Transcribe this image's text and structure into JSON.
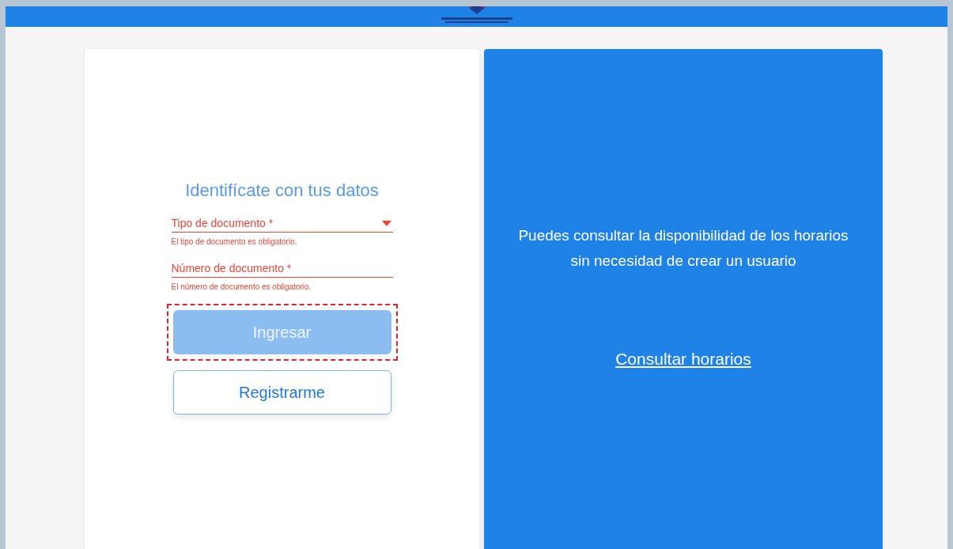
{
  "login": {
    "title": "Identifícate con tus datos",
    "fields": [
      {
        "kind": "select",
        "label": "Tipo de documento *",
        "error": "El tipo de documento es obligatorio.",
        "invalid": true
      },
      {
        "kind": "text",
        "label": "Número de documento *",
        "error": "El número de documento es obligatorio.",
        "invalid": true
      }
    ],
    "buttons": [
      {
        "kind": "primary",
        "label": "Ingresar",
        "disabled": true,
        "highlighted": true
      },
      {
        "kind": "outline",
        "label": "Registrarme",
        "disabled": false,
        "highlighted": false
      }
    ]
  },
  "info": {
    "message": "Puedes consultar la disponibilidad de los horarios sin necesidad de crear un usuario",
    "link": "Consultar horarios"
  }
}
